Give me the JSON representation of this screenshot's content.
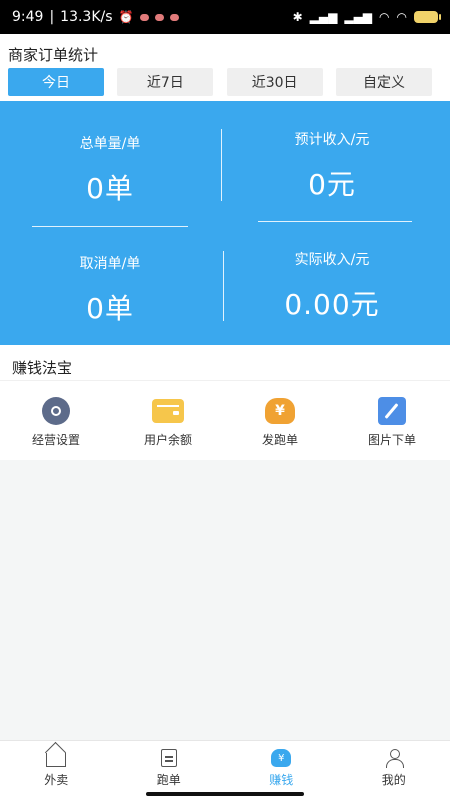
{
  "status_bar": {
    "time": "9:49",
    "speed": "13.3K/s",
    "battery_level": "47"
  },
  "section_title": "商家订单统计",
  "range_tabs": [
    {
      "label": "今日",
      "active": true
    },
    {
      "label": "近7日",
      "active": false
    },
    {
      "label": "近30日",
      "active": false
    },
    {
      "label": "自定义",
      "active": false
    }
  ],
  "stats": {
    "total_orders": {
      "label": "总单量/单",
      "value": "0单"
    },
    "expected_income": {
      "label": "预计收入/元",
      "value": "0元"
    },
    "cancelled_orders": {
      "label": "取消单/单",
      "value": "0单"
    },
    "actual_income": {
      "label": "实际收入/元",
      "value": "0.00元"
    }
  },
  "tools_title": "赚钱法宝",
  "tools": [
    {
      "label": "经营设置",
      "icon": "gear-icon"
    },
    {
      "label": "用户余额",
      "icon": "wallet-icon"
    },
    {
      "label": "发跑单",
      "icon": "money-bag-icon",
      "icon_text": "¥"
    },
    {
      "label": "图片下单",
      "icon": "edit-icon"
    }
  ],
  "tabbar": [
    {
      "label": "外卖",
      "icon": "home-icon",
      "active": false
    },
    {
      "label": "跑单",
      "icon": "clipboard-icon",
      "active": false
    },
    {
      "label": "赚钱",
      "icon": "money-bag-icon",
      "icon_text": "¥",
      "active": true
    },
    {
      "label": "我的",
      "icon": "user-icon",
      "active": false
    }
  ],
  "colors": {
    "accent": "#3aa8ee",
    "gear": "#5d6b8a",
    "wallet": "#f6c64b",
    "bag": "#f0a233",
    "picture": "#4d8ee6"
  }
}
